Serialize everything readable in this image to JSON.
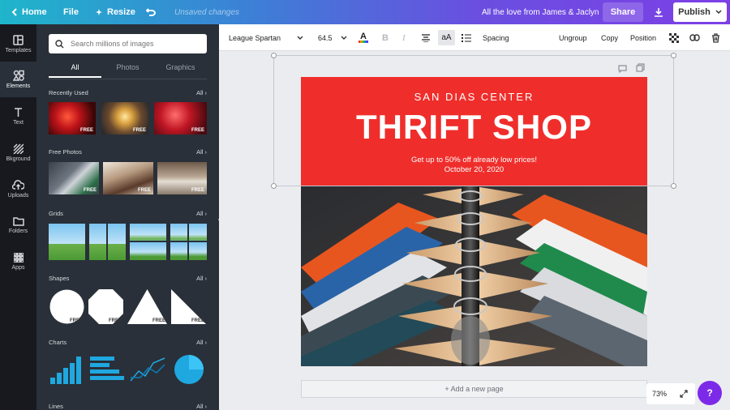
{
  "topbar": {
    "home_label": "Home",
    "file_label": "File",
    "resize_label": "Resize",
    "unsaved_label": "Unsaved changes",
    "design_title": "All the love from James & Jaclyn",
    "share_label": "Share",
    "publish_label": "Publish"
  },
  "rail": {
    "items": [
      {
        "label": "Templates",
        "icon": "templates-icon"
      },
      {
        "label": "Elements",
        "icon": "elements-icon"
      },
      {
        "label": "Text",
        "icon": "text-icon"
      },
      {
        "label": "Bkground",
        "icon": "background-icon"
      },
      {
        "label": "Uploads",
        "icon": "uploads-icon"
      },
      {
        "label": "Folders",
        "icon": "folders-icon"
      },
      {
        "label": "Apps",
        "icon": "apps-icon"
      }
    ],
    "active": "Elements"
  },
  "panel": {
    "search_placeholder": "Search millions of images",
    "tabs": [
      "All",
      "Photos",
      "Graphics"
    ],
    "active_tab": "All",
    "sections": [
      {
        "title": "Recently Used",
        "action": "All"
      },
      {
        "title": "Free Photos",
        "action": "All"
      },
      {
        "title": "Grids",
        "action": "All"
      },
      {
        "title": "Shapes",
        "action": "All"
      },
      {
        "title": "Charts",
        "action": "All"
      },
      {
        "title": "Lines",
        "action": "All"
      }
    ],
    "free_badge": "FREE"
  },
  "toolbar": {
    "font_family": "League Spartan",
    "font_size": "64.5",
    "bold": "B",
    "italic": "I",
    "case": "aA",
    "spacing_label": "Spacing",
    "ungroup_label": "Ungroup",
    "copy_label": "Copy",
    "position_label": "Position"
  },
  "design": {
    "eyebrow": "SAN DIAS CENTER",
    "headline": "THRIFT SHOP",
    "subline": "Get up to 50% off already low prices!",
    "date": "October 20, 2020",
    "banner_color": "#ef2e2b"
  },
  "canvas": {
    "add_page_label": "+ Add a new page",
    "zoom": "73%",
    "help": "?"
  },
  "colors": {
    "accent": "#7d2ae8",
    "sidebar": "#293039",
    "rail": "#18191f"
  }
}
